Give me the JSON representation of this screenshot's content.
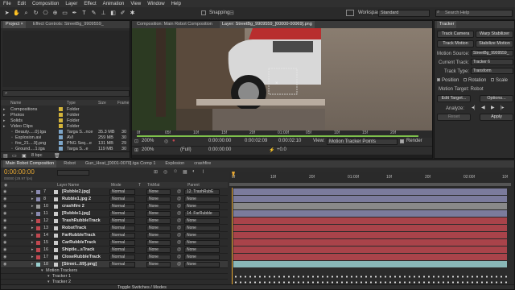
{
  "menu": [
    "File",
    "Edit",
    "Composition",
    "Layer",
    "Effect",
    "Animation",
    "View",
    "Window",
    "Help"
  ],
  "toolbar": {
    "snapping": "Snapping",
    "workspace_label": "Workspace:",
    "workspace_value": "Standard",
    "search_placeholder": "Search Help"
  },
  "project_panel": {
    "tabs": [
      "Project ×",
      "Effect Controls: StreetBg_9909559_"
    ],
    "columns": [
      "Name",
      "Type",
      "Size",
      "Frame"
    ],
    "items": [
      {
        "name": "Compositions",
        "type": "Folder",
        "size": "",
        "frame": "",
        "color": "#d4b43a",
        "indent": 0
      },
      {
        "name": "Photos",
        "type": "Folder",
        "size": "",
        "frame": "",
        "color": "#d4b43a",
        "indent": 0
      },
      {
        "name": "Solids",
        "type": "Folder",
        "size": "",
        "frame": "",
        "color": "#d4b43a",
        "indent": 0
      },
      {
        "name": "Video Clips",
        "type": "Folder",
        "size": "",
        "frame": "",
        "color": "#d4b43a",
        "indent": 0
      },
      {
        "name": "Beauty.....0].tga",
        "type": "Targa S...nce",
        "size": "35.3 MB",
        "frame": "30",
        "color": "#7da6c9",
        "indent": 1
      },
      {
        "name": "Explosion.avi",
        "type": "AVI",
        "size": "259 MB",
        "frame": "30",
        "color": "#7da6c9",
        "indent": 1
      },
      {
        "name": "fire_21....9].png",
        "type": "PNG Seq...e",
        "size": "131 MB",
        "frame": "29",
        "color": "#7da6c9",
        "indent": 1
      },
      {
        "name": "Ground....1.tga",
        "type": "Targa S...e",
        "size": "119 MB",
        "frame": "30",
        "color": "#7da6c9",
        "indent": 1
      }
    ],
    "footer_bpc": "8 bpc"
  },
  "viewer": {
    "tabs": [
      "Composition: Main Robot Composition",
      "Layer: StreetBg_9909559_[00000-00069].png"
    ],
    "ruler": [
      "0f",
      "05f",
      "10f",
      "15f",
      "20f",
      "01:00f",
      "05f",
      "10f",
      "15f",
      "20f"
    ],
    "bar1": {
      "zoom": "200%",
      "time1": "0:00:00:00",
      "time2": "0:00:02:09",
      "time3": "0:00:02:10",
      "dur": "Δ 0:00:02:10",
      "view_label": "View:",
      "view_value": "Motion Tracker Points",
      "render": "Render"
    },
    "bar2": {
      "zoom": "200%",
      "res": "(Full)",
      "time": "0:00:00:00",
      "offset": "+0.0"
    }
  },
  "tracker": {
    "title": "Tracker",
    "btn_track_camera": "Track Camera",
    "btn_warp": "Warp Stabilizer",
    "btn_track_motion": "Track Motion",
    "btn_stabilize": "Stabilize Motion",
    "motion_source_label": "Motion Source:",
    "motion_source_value": "StreetBg_9909559_",
    "current_track_label": "Current Track:",
    "current_track_value": "Tracker 6",
    "track_type_label": "Track Type:",
    "track_type_value": "Transform",
    "cb_position": "Position",
    "cb_rotation": "Rotation",
    "cb_scale": "Scale",
    "motion_target": "Motion Target: Robot",
    "btn_edit_target": "Edit Target...",
    "btn_options": "Options...",
    "analyze_label": "Analyze:",
    "btn_reset": "Reset",
    "btn_apply": "Apply"
  },
  "timeline": {
    "tabs": [
      "Main Robot Composition",
      "Robot",
      "Gun_Heat_[0001-0070].tga Comp 1",
      "Explosion",
      "crashfire"
    ],
    "timecode": "0:00:00:00",
    "timecode_sub": "00000 (29.97 fps)",
    "columns": {
      "name": "Layer Name",
      "mode": "Mode",
      "t": "T",
      "trkmat": "TrkMat",
      "parent": "Parent"
    },
    "ruler": [
      "0f",
      "10f",
      "20f",
      "01:00f",
      "10f",
      "20f",
      "02:00f",
      "10f"
    ],
    "layers": [
      {
        "num": "7",
        "name": "[Rubble2.jpg]",
        "mode": "Normal",
        "trkmat": "None",
        "parent": "12. TrashRubE",
        "color": "#8a8ab0"
      },
      {
        "num": "8",
        "name": "Rubble1.jpg 2",
        "mode": "Normal",
        "trkmat": "None",
        "parent": "None",
        "color": "#8a8ab0"
      },
      {
        "num": "10",
        "name": "crashfire 2",
        "mode": "Normal",
        "trkmat": "None",
        "parent": "None",
        "color": "#9a9a9a"
      },
      {
        "num": "11",
        "name": "[Rubble1.jpg]",
        "mode": "Normal",
        "trkmat": "None",
        "parent": "14. FarRubble",
        "color": "#8a8ab0"
      },
      {
        "num": "12",
        "name": "TrashRubbleTrack",
        "mode": "Normal",
        "trkmat": "None",
        "parent": "None",
        "color": "#c04850"
      },
      {
        "num": "13",
        "name": "RobotTrack",
        "mode": "Normal",
        "trkmat": "None",
        "parent": "None",
        "color": "#c04850"
      },
      {
        "num": "14",
        "name": "FarRubbleTrack",
        "mode": "Normal",
        "trkmat": "None",
        "parent": "None",
        "color": "#c04850"
      },
      {
        "num": "15",
        "name": "CarRubbleTrack",
        "mode": "Normal",
        "trkmat": "None",
        "parent": "None",
        "color": "#c04850"
      },
      {
        "num": "16",
        "name": "Shiptle...sTrack",
        "mode": "Normal",
        "trkmat": "None",
        "parent": "None",
        "color": "#c04850"
      },
      {
        "num": "17",
        "name": "CloseRubbleTrack",
        "mode": "Normal",
        "trkmat": "None",
        "parent": "None",
        "color": "#c04850"
      },
      {
        "num": "18",
        "name": "[Street...69].png]",
        "mode": "Normal",
        "trkmat": "None",
        "parent": "None",
        "color": "#9ad0d0"
      }
    ],
    "sub_rows": [
      "Motion Trackers",
      "Tracker 1",
      "Tracker 2"
    ],
    "toggle_label": "Toggle Switches / Modes"
  }
}
